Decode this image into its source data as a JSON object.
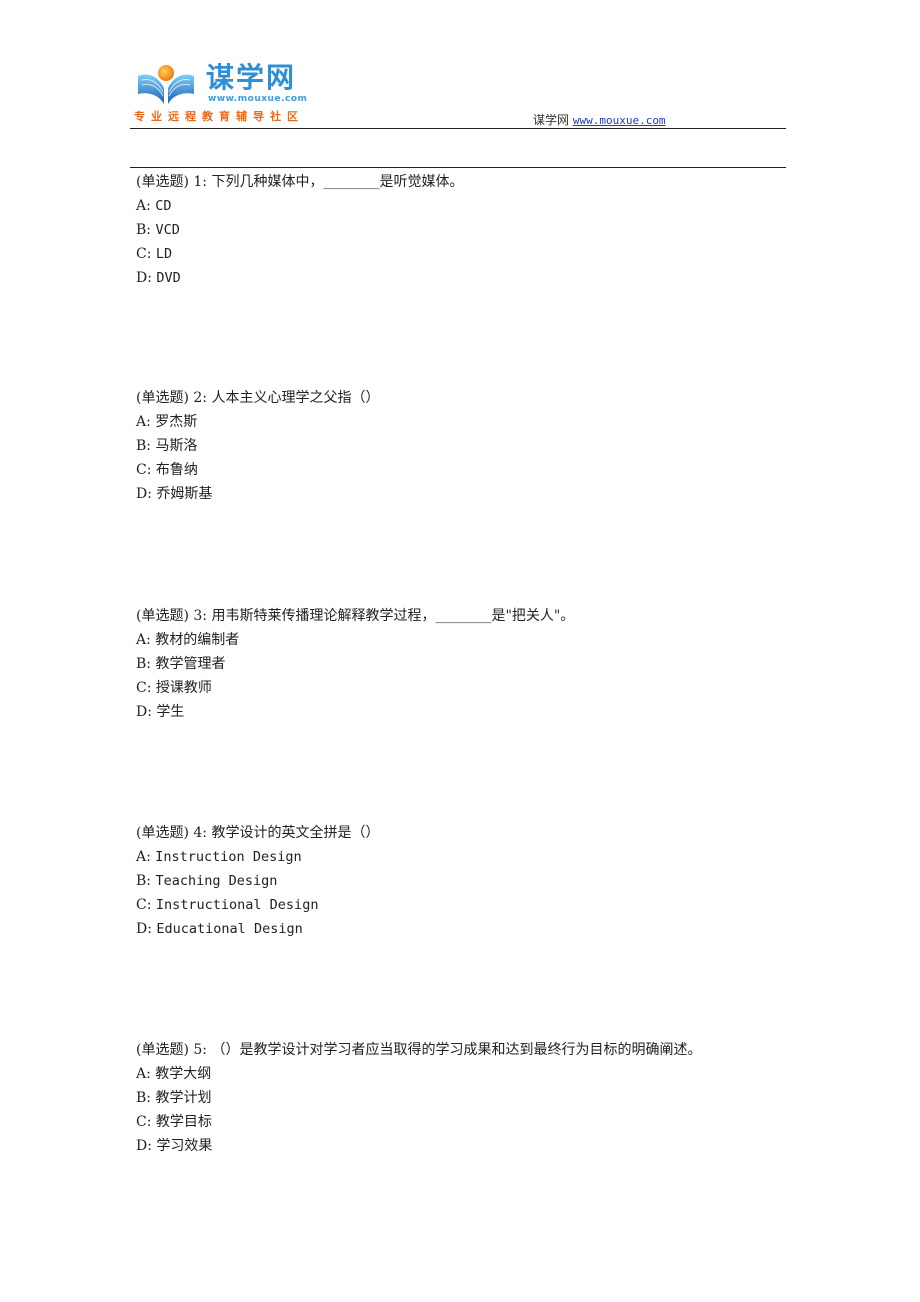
{
  "header": {
    "logo": {
      "title": "谋学网",
      "url": "www.mouxue.com",
      "slogan": "专业远程教育辅导社区",
      "colors": {
        "title": "#2f8fd6",
        "slogan": "#e86a1a",
        "sun": "#f5a623"
      }
    },
    "site_name": "谋学网",
    "site_link": "www.mouxue.com",
    "link_color": "#1a3cc8"
  },
  "questions": [
    {
      "type": "(单选题)",
      "number": "1:",
      "text": "下列几种媒体中，________是听觉媒体。",
      "options": [
        {
          "key": "A:",
          "text": "CD"
        },
        {
          "key": "B:",
          "text": "VCD"
        },
        {
          "key": "C:",
          "text": "LD"
        },
        {
          "key": "D:",
          "text": "DVD"
        }
      ]
    },
    {
      "type": "(单选题)",
      "number": "2:",
      "text": "人本主义心理学之父指（）",
      "options": [
        {
          "key": "A:",
          "text": "罗杰斯"
        },
        {
          "key": "B:",
          "text": "马斯洛"
        },
        {
          "key": "C:",
          "text": "布鲁纳"
        },
        {
          "key": "D:",
          "text": "乔姆斯基"
        }
      ]
    },
    {
      "type": "(单选题)",
      "number": "3:",
      "text": "用韦斯特莱传播理论解释教学过程，________是\"把关人\"。",
      "options": [
        {
          "key": "A:",
          "text": "教材的编制者"
        },
        {
          "key": "B:",
          "text": "教学管理者"
        },
        {
          "key": "C:",
          "text": "授课教师"
        },
        {
          "key": "D:",
          "text": "学生"
        }
      ]
    },
    {
      "type": "(单选题)",
      "number": "4:",
      "text": "教学设计的英文全拼是（）",
      "options": [
        {
          "key": "A:",
          "text": "Instruction Design"
        },
        {
          "key": "B:",
          "text": "Teaching Design"
        },
        {
          "key": "C:",
          "text": "Instructional Design"
        },
        {
          "key": "D:",
          "text": "Educational Design"
        }
      ]
    },
    {
      "type": "(单选题)",
      "number": "5:",
      "text": "（）是教学设计对学习者应当取得的学习成果和达到最终行为目标的明确阐述。",
      "options": [
        {
          "key": "A:",
          "text": "教学大纲"
        },
        {
          "key": "B:",
          "text": "教学计划"
        },
        {
          "key": "C:",
          "text": "教学目标"
        },
        {
          "key": "D:",
          "text": "学习效果"
        }
      ]
    }
  ]
}
